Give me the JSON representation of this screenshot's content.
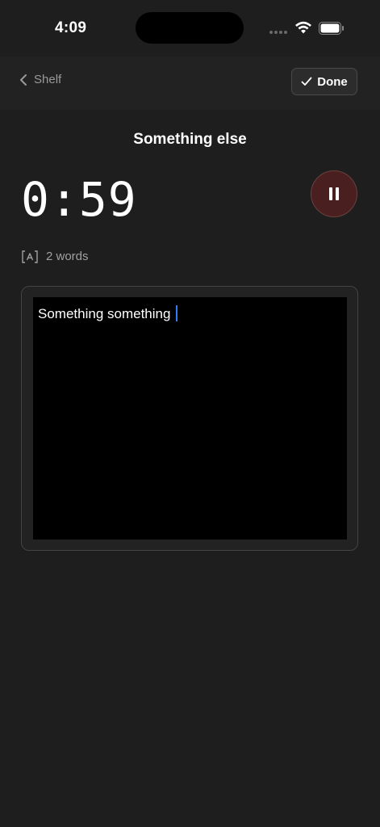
{
  "status_bar": {
    "time": "4:09"
  },
  "nav": {
    "back_label": "Shelf",
    "done_label": "Done"
  },
  "page": {
    "title": "Something else"
  },
  "timer": {
    "value": "0:59"
  },
  "word_count": {
    "label": "2 words"
  },
  "editor": {
    "text": "Something something "
  },
  "colors": {
    "background": "#1e1e1e",
    "nav_background": "#222222",
    "pause_button": "#4a1f1f",
    "caret": "#2f7cf6",
    "editor_background": "#000000"
  },
  "icons": {
    "back": "chevron-left-icon",
    "done": "checkmark-icon",
    "pause": "pause-icon",
    "word_count": "text-box-icon",
    "wifi": "wifi-icon",
    "battery": "battery-icon"
  }
}
